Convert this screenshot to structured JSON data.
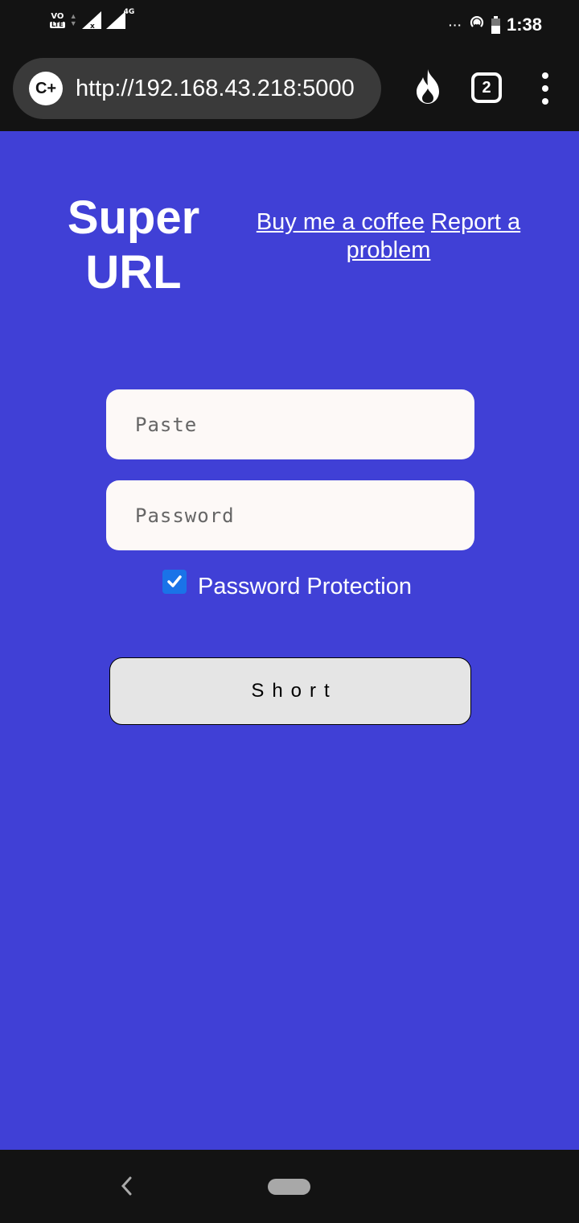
{
  "status_bar": {
    "volte_top": "VO",
    "volte_bottom": "LTE",
    "network": "4G",
    "dots": "···",
    "time": "1:38"
  },
  "browser": {
    "site_icon": "C+",
    "url": "http://192.168.43.218:5000",
    "tabs_count": "2"
  },
  "page": {
    "logo": "Super URL",
    "links": [
      {
        "label": "Buy me a coffee"
      },
      {
        "label": "Report a problem"
      }
    ],
    "url_input": {
      "placeholder": "Paste",
      "value": ""
    },
    "password_input": {
      "placeholder": "Password",
      "value": ""
    },
    "password_protection": {
      "label": "Password Protection",
      "checked": true
    },
    "short_button": "Short",
    "background_color": "#4040d6"
  },
  "icons": {
    "fire": "fire-icon",
    "tabs": "tabs-icon",
    "menu": "more-vert-icon",
    "back": "back-icon",
    "home": "home-pill-icon"
  }
}
